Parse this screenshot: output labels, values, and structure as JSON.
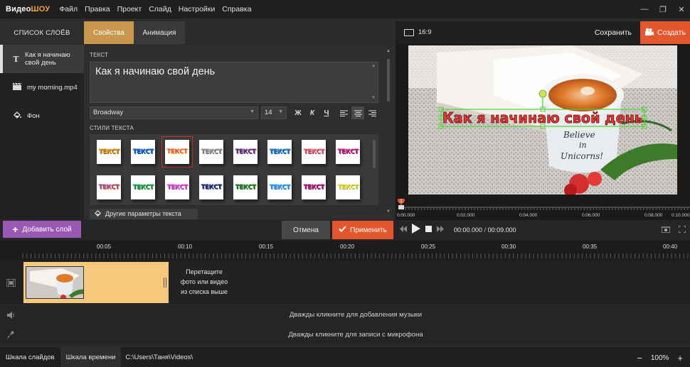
{
  "app": {
    "logo_prefix": "Видео",
    "logo_suffix": "ШОУ"
  },
  "menu": [
    "Файл",
    "Правка",
    "Проект",
    "Слайд",
    "Настройки",
    "Справка"
  ],
  "layers_panel": {
    "header": "СПИСОК СЛОЁВ",
    "items": [
      {
        "label": "Как я начинаю свой день",
        "icon": "text-icon"
      },
      {
        "label": "my morning.mp4",
        "icon": "video-clip-icon"
      },
      {
        "label": "Фон",
        "icon": "paint-bucket-icon"
      }
    ]
  },
  "tabs": {
    "properties": "Свойства",
    "animation": "Анимация"
  },
  "properties": {
    "text_section_label": "ТЕКСТ",
    "text_value": "Как я начинаю свой день",
    "font": "Broadway",
    "size": "14",
    "styles_label": "СТИЛИ ТЕКСТА",
    "style_sample": "ТЕКСТ",
    "other_params": "Другие параметры текста",
    "format_buttons": {
      "bold": "Ж",
      "italic": "К",
      "underline": "Ч"
    }
  },
  "text_styles": [
    {
      "color": "#f39c12",
      "shadow": "#7a4a00"
    },
    {
      "color": "#1565c0",
      "shadow": "#0d47a1"
    },
    {
      "color": "#e74c3c",
      "shadow": "#fbc02d"
    },
    {
      "color": "#9e9e9e",
      "shadow": "#616161"
    },
    {
      "color": "#2c3e9e",
      "shadow": "#c62828"
    },
    {
      "color": "#1e88e5",
      "shadow": "#0b3d75"
    },
    {
      "color": "#e57373",
      "shadow": "#ad1457"
    },
    {
      "color": "#d81b60",
      "shadow": "#6a1b9a"
    },
    {
      "color": "#8e44ad",
      "shadow": "#ef6c00"
    },
    {
      "color": "#27ae60",
      "shadow": "#1b5e20"
    },
    {
      "color": "#e056c8",
      "shadow": "#8e24aa"
    },
    {
      "color": "#1a237e",
      "shadow": "#455a64"
    },
    {
      "color": "#2e7d32",
      "shadow": "#1b5e20"
    },
    {
      "color": "#42a5f5",
      "shadow": "#1565c0"
    },
    {
      "color": "#c2185b",
      "shadow": "#4a148c"
    },
    {
      "color": "#fdd835",
      "shadow": "#7cb342"
    }
  ],
  "preview": {
    "aspect": "16:9",
    "save": "Сохранить",
    "create": "Создать",
    "overlay_text": "Как я начинаю свой день",
    "cup_text": [
      "Believe",
      "in",
      "Unicorns!"
    ],
    "marker": "1",
    "ruler_labels": [
      "0:00.000",
      "0:02.000",
      "0:04.000",
      "0:06.000",
      "0:08.000",
      "0:10.000"
    ]
  },
  "toolbar": {
    "add_layer": "Добавить слой",
    "cancel": "Отмена",
    "apply": "Применить",
    "time_current": "00:00.000",
    "time_separator": "/",
    "time_total": "00:09.000"
  },
  "timeline": {
    "ticks": [
      "00:05",
      "00:10",
      "00:15",
      "00:20",
      "00:25",
      "00:30",
      "00:35",
      "00:40"
    ],
    "drop_hint": [
      "Перетащите",
      "фото или видео",
      "из списка выше"
    ],
    "music_hint": "Дважды кликните для добавления музыки",
    "mic_hint": "Дважды кликните для записи с микрофона"
  },
  "statusbar": {
    "slides_tab": "Шкала слайдов",
    "timeline_tab": "Шкала времени",
    "path": "C:\\Users\\Таня\\Videos\\",
    "zoom_minus": "−",
    "zoom_value": "100%",
    "zoom_plus": "+"
  },
  "colors": {
    "accent_orange": "#e4572e",
    "tab_gold": "#c8974d",
    "add_purple": "#9b59b6",
    "clip_yellow": "#f6c87b",
    "selection_green": "#4cd137"
  }
}
